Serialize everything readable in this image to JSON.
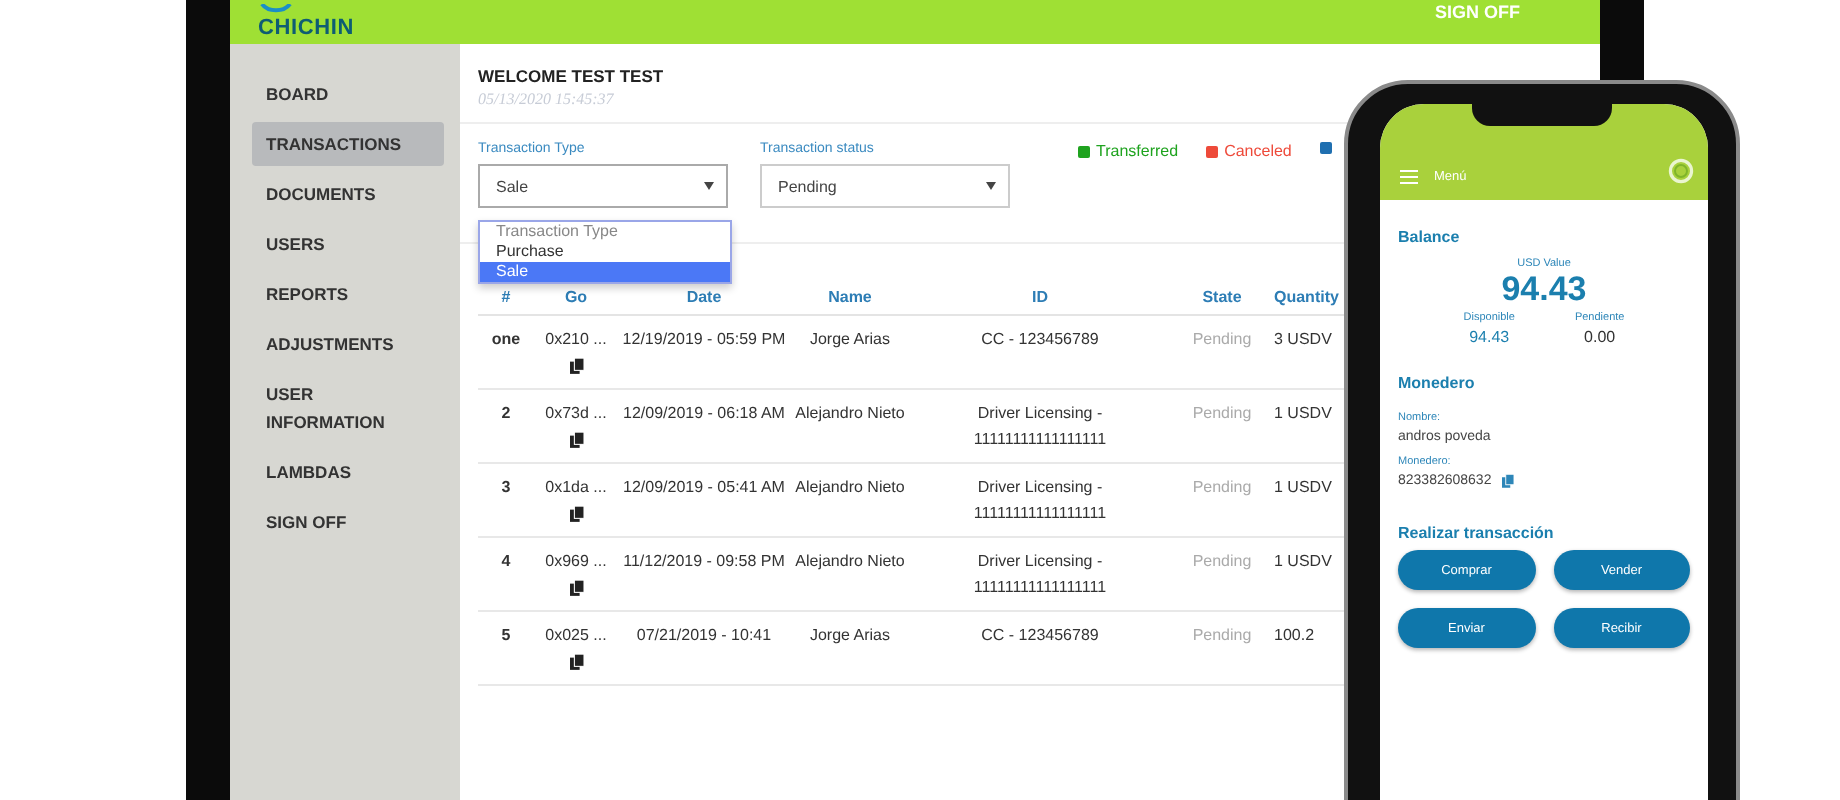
{
  "header": {
    "logo": "CHICHIN",
    "sign_off": "SIGN OFF"
  },
  "sidebar": {
    "items": [
      {
        "label": "BOARD",
        "selected": false
      },
      {
        "label": "TRANSACTIONS",
        "selected": true
      },
      {
        "label": "DOCUMENTS",
        "selected": false
      },
      {
        "label": "USERS",
        "selected": false
      },
      {
        "label": "REPORTS",
        "selected": false
      },
      {
        "label": "ADJUSTMENTS",
        "selected": false
      },
      {
        "label": "USER INFORMATION",
        "selected": false
      },
      {
        "label": "LAMBDAS",
        "selected": false
      },
      {
        "label": "SIGN OFF",
        "selected": false
      }
    ]
  },
  "welcome": {
    "title": "WELCOME TEST TEST",
    "timestamp": "05/13/2020 15:45:37"
  },
  "filters": [
    {
      "label": "Transaction Type",
      "value": "Sale",
      "expanded": true,
      "options": [
        {
          "label": "Transaction Type",
          "selected": false
        },
        {
          "label": "Purchase",
          "selected": false
        },
        {
          "label": "Sale",
          "selected": true
        }
      ]
    },
    {
      "label": "Transaction status",
      "value": "Pending",
      "expanded": false
    }
  ],
  "legend": [
    {
      "label": "Transferred",
      "color": "#1fa31f"
    },
    {
      "label": "Canceled",
      "color": "#ee4a3a"
    },
    {
      "color": "#1f6fb0"
    }
  ],
  "table": {
    "columns": [
      "#",
      "Go",
      "Date",
      "Name",
      "ID",
      "State",
      "Quantity"
    ],
    "rows": [
      {
        "number": "one",
        "go": "0x210 ...",
        "date": "12/19/2019 - 05:59 PM",
        "name": "Jorge Arias",
        "id": "CC - 123456789",
        "state": "Pending",
        "quantity": "3 USDV"
      },
      {
        "number": "2",
        "go": "0x73d ...",
        "date": "12/09/2019 - 06:18 AM",
        "name": "Alejandro Nieto",
        "id": "Driver Licensing - 11111111111111111",
        "state": "Pending",
        "quantity": "1 USDV"
      },
      {
        "number": "3",
        "go": "0x1da ...",
        "date": "12/09/2019 - 05:41 AM",
        "name": "Alejandro Nieto",
        "id": "Driver Licensing - 11111111111111111",
        "state": "Pending",
        "quantity": "1 USDV"
      },
      {
        "number": "4",
        "go": "0x969 ...",
        "date": "11/12/2019 - 09:58 PM",
        "name": "Alejandro Nieto",
        "id": "Driver Licensing - 11111111111111111",
        "state": "Pending",
        "quantity": "1 USDV"
      },
      {
        "number": "5",
        "go": "0x025 ...",
        "date": "07/21/2019 - 10:41",
        "name": "Jorge Arias",
        "id": "CC - 123456789",
        "state": "Pending",
        "quantity": "100.2"
      }
    ]
  },
  "phone": {
    "menu": "Menú",
    "balance": {
      "title": "Balance",
      "usd_label": "USD Value",
      "usd_value": "94.43",
      "available_label": "Disponible",
      "available": "94.43",
      "pending_label": "Pendiente",
      "pending": "0.00"
    },
    "wallet": {
      "title": "Monedero",
      "name_label": "Nombre:",
      "name": "andros poveda",
      "wallet_label": "Monedero:",
      "wallet": "823382608632"
    },
    "actions": {
      "title": "Realizar transacción",
      "buttons": [
        "Comprar",
        "Vender",
        "Enviar",
        "Recibir"
      ]
    }
  }
}
